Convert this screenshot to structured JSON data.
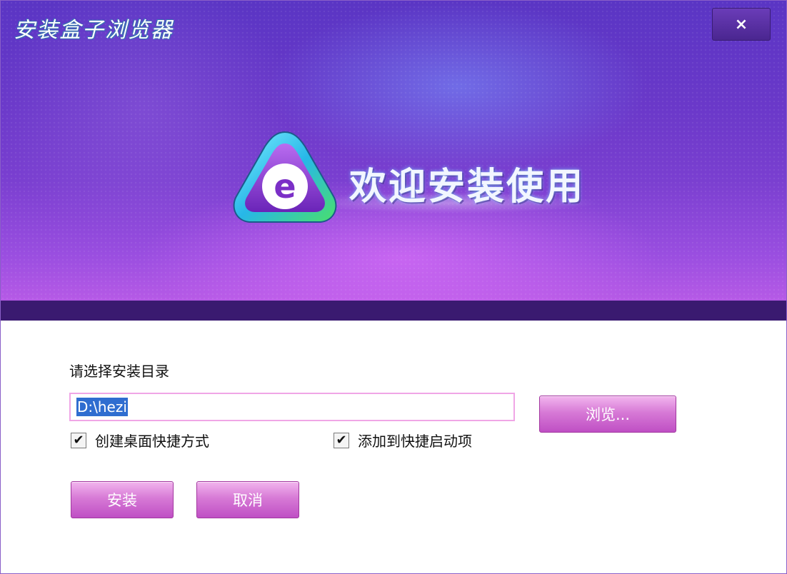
{
  "window": {
    "title": "安装盒子浏览器",
    "close_label": "×"
  },
  "banner": {
    "welcome_text": "欢迎安装使用",
    "logo_letter": "e"
  },
  "form": {
    "directory_label": "请选择安装目录",
    "install_path": "D:\\hezi",
    "browse_label": "浏览...",
    "checkbox_desktop_shortcut": {
      "label": "创建桌面快捷方式",
      "checked": true,
      "mark": "✔"
    },
    "checkbox_startup_item": {
      "label": "添加到快捷启动项",
      "checked": true,
      "mark": "✔"
    },
    "install_label": "安装",
    "cancel_label": "取消"
  },
  "colors": {
    "banner_top": "#5a35c4",
    "banner_bottom": "#b65ae6",
    "strip": "#3a1a70",
    "button_pink": "#d77ad6",
    "input_border": "#f0a6e6",
    "selection": "#2f6dd0"
  }
}
